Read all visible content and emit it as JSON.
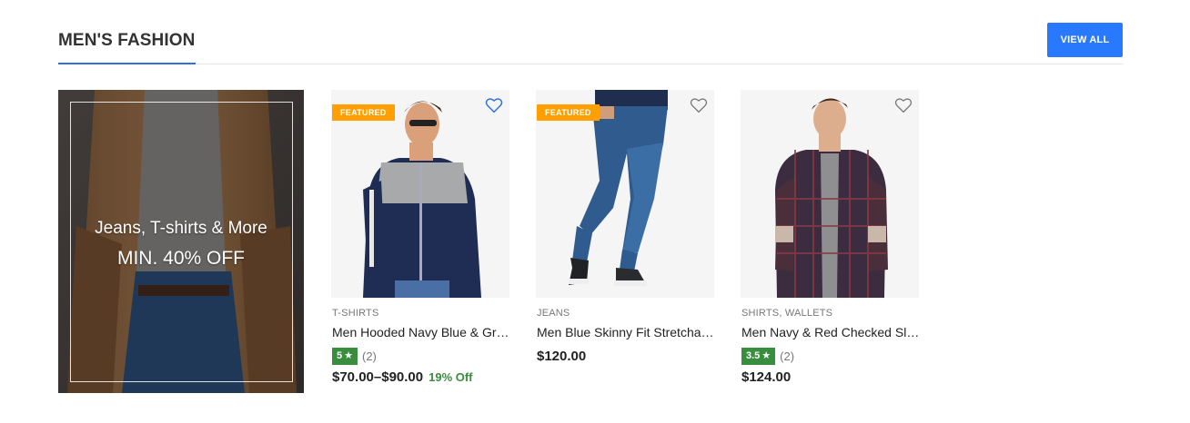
{
  "section": {
    "title": "MEN'S FASHION",
    "view_all_label": "VIEW ALL",
    "accent_color": "#2979ff"
  },
  "banner": {
    "line1": "Jeans, T-shirts & More",
    "line2": "MIN. 40% OFF"
  },
  "products": [
    {
      "badge": "FEATURED",
      "wishlist_active": true,
      "category": "T-SHIRTS",
      "name": "Men Hooded Navy Blue & Grey T-shirt",
      "rating": "5",
      "rating_count": "(2)",
      "price": "$70.00–$90.00",
      "discount": "19% Off"
    },
    {
      "badge": "FEATURED",
      "wishlist_active": false,
      "category": "JEANS",
      "name": "Men Blue Skinny Fit Stretchable Jeans",
      "price": "$120.00"
    },
    {
      "wishlist_active": false,
      "category": "SHIRTS, WALLETS",
      "name": "Men Navy & Red Checked Slim Fit Shirt",
      "rating": "3.5",
      "rating_count": "(2)",
      "price": "$124.00"
    }
  ],
  "icons": [
    "heart-outline-icon",
    "star-icon"
  ],
  "colors": {
    "featured_badge": "#ffa000",
    "rating_badge": "#388e3c",
    "discount": "#388e3c"
  }
}
